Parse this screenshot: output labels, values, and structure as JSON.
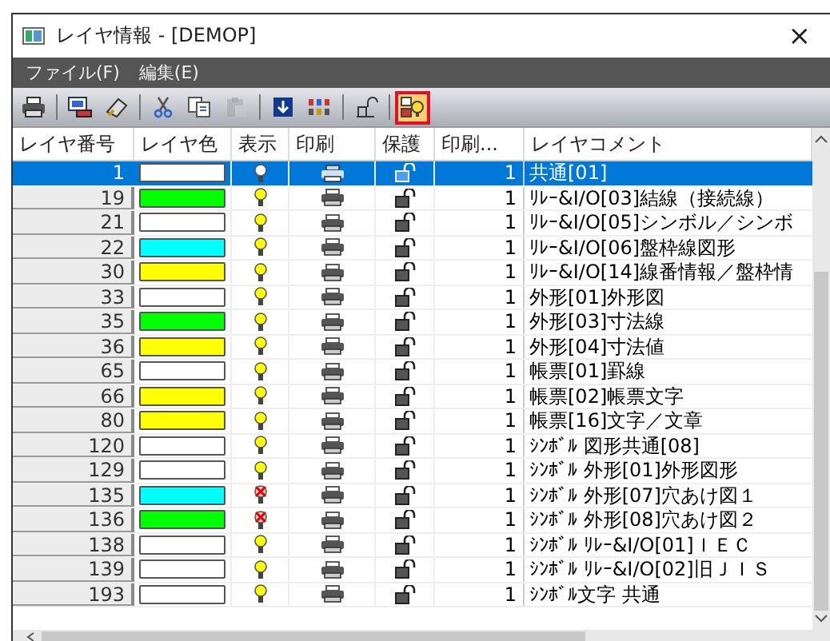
{
  "window": {
    "title": "レイヤ情報 - [DEMOP]",
    "close": "×"
  },
  "menu": [
    {
      "label": "ファイル(F)"
    },
    {
      "label": "編集(E)"
    }
  ],
  "toolbar": [
    {
      "disabled": false,
      "highlighted": false
    },
    {
      "disabled": false,
      "highlighted": false
    },
    {
      "disabled": false,
      "highlighted": false
    },
    {
      "disabled": false,
      "highlighted": false
    },
    {
      "disabled": false,
      "highlighted": false
    },
    {
      "disabled": true,
      "highlighted": false
    },
    {
      "disabled": false,
      "highlighted": false
    },
    {
      "disabled": false,
      "highlighted": false
    },
    {
      "disabled": false,
      "highlighted": false
    },
    {
      "disabled": false,
      "highlighted": true
    }
  ],
  "table": {
    "columns": [
      "レイヤ番号",
      "レイヤ色",
      "表示",
      "印刷",
      "保護",
      "印刷...",
      "レイヤコメント"
    ],
    "rows": [
      {
        "number": "1",
        "color": "#ffffff",
        "visible": true,
        "selected": true,
        "print_count": "1",
        "comment": "共通[01]"
      },
      {
        "number": "19",
        "color": "#00ff00",
        "visible": true,
        "selected": false,
        "print_count": "1",
        "comment": "ﾘﾚｰ&I/O[03]結線（接続線）"
      },
      {
        "number": "21",
        "color": "#ffffff",
        "visible": true,
        "selected": false,
        "print_count": "1",
        "comment": "ﾘﾚｰ&I/O[05]シンボル／シンボ"
      },
      {
        "number": "22",
        "color": "#00ffff",
        "visible": true,
        "selected": false,
        "print_count": "1",
        "comment": "ﾘﾚｰ&I/O[06]盤枠線図形"
      },
      {
        "number": "30",
        "color": "#ffff00",
        "visible": true,
        "selected": false,
        "print_count": "1",
        "comment": "ﾘﾚｰ&I/O[14]線番情報／盤枠情"
      },
      {
        "number": "33",
        "color": "#ffffff",
        "visible": true,
        "selected": false,
        "print_count": "1",
        "comment": "外形[01]外形図"
      },
      {
        "number": "35",
        "color": "#00ff00",
        "visible": true,
        "selected": false,
        "print_count": "1",
        "comment": "外形[03]寸法線"
      },
      {
        "number": "36",
        "color": "#ffff00",
        "visible": true,
        "selected": false,
        "print_count": "1",
        "comment": "外形[04]寸法値"
      },
      {
        "number": "65",
        "color": "#ffffff",
        "visible": true,
        "selected": false,
        "print_count": "1",
        "comment": "帳票[01]罫線"
      },
      {
        "number": "66",
        "color": "#ffff00",
        "visible": true,
        "selected": false,
        "print_count": "1",
        "comment": "帳票[02]帳票文字"
      },
      {
        "number": "80",
        "color": "#ffff00",
        "visible": true,
        "selected": false,
        "print_count": "1",
        "comment": "帳票[16]文字／文章"
      },
      {
        "number": "120",
        "color": "#ffffff",
        "visible": true,
        "selected": false,
        "print_count": "1",
        "comment": "ｼﾝﾎﾞﾙ 図形共通[08]"
      },
      {
        "number": "129",
        "color": "#ffffff",
        "visible": true,
        "selected": false,
        "print_count": "1",
        "comment": "ｼﾝﾎﾞﾙ 外形[01]外形図形"
      },
      {
        "number": "135",
        "color": "#00ffff",
        "visible": false,
        "selected": false,
        "print_count": "1",
        "comment": "ｼﾝﾎﾞﾙ 外形[07]穴あけ図１"
      },
      {
        "number": "136",
        "color": "#00ff00",
        "visible": false,
        "selected": false,
        "print_count": "1",
        "comment": "ｼﾝﾎﾞﾙ 外形[08]穴あけ図２"
      },
      {
        "number": "138",
        "color": "#ffffff",
        "visible": true,
        "selected": false,
        "print_count": "1",
        "comment": "ｼﾝﾎﾞﾙ ﾘﾚｰ&I/O[01]ＩＥＣ"
      },
      {
        "number": "139",
        "color": "#ffffff",
        "visible": true,
        "selected": false,
        "print_count": "1",
        "comment": "ｼﾝﾎﾞﾙ ﾘﾚｰ&I/O[02]旧ＪＩＳ"
      },
      {
        "number": "193",
        "color": "#ffffff",
        "visible": true,
        "selected": false,
        "print_count": "1",
        "comment": "ｼﾝﾎﾞﾙ文字 共通"
      }
    ]
  }
}
